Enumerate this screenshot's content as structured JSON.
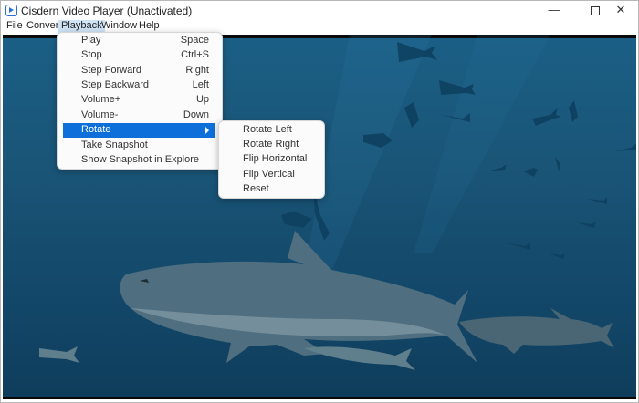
{
  "window": {
    "title": "Cisdern Video Player (Unactivated)"
  },
  "window_controls": {
    "minimize": "—",
    "close": "✕"
  },
  "menubar": [
    {
      "label": "File"
    },
    {
      "label": "Convert"
    },
    {
      "label": "Playback"
    },
    {
      "label": "Window"
    },
    {
      "label": "Help"
    }
  ],
  "playback_menu": {
    "items": [
      {
        "label": "Play",
        "shortcut": "Space"
      },
      {
        "label": "Stop",
        "shortcut": "Ctrl+S"
      },
      {
        "label": "Step Forward",
        "shortcut": "Right"
      },
      {
        "label": "Step Backward",
        "shortcut": "Left"
      },
      {
        "label": "Volume+",
        "shortcut": "Up"
      },
      {
        "label": "Volume-",
        "shortcut": "Down"
      },
      {
        "label": "Rotate",
        "shortcut": ""
      },
      {
        "label": "Take Snapshot",
        "shortcut": ""
      },
      {
        "label": "Show Snapshot in Explore",
        "shortcut": ""
      }
    ]
  },
  "rotate_menu": {
    "items": [
      {
        "label": "Rotate Left"
      },
      {
        "label": "Rotate Right"
      },
      {
        "label": "Flip Horizontal"
      },
      {
        "label": "Flip Vertical"
      },
      {
        "label": "Reset"
      }
    ]
  },
  "colors": {
    "accent": "#0d6fd9",
    "menu_highlight": "#cfe4f7",
    "water_top": "#1b5f86",
    "water_bottom": "#0f3d5c"
  },
  "icons": {
    "app": "play-icon",
    "submenu": "chevron-right-icon"
  }
}
